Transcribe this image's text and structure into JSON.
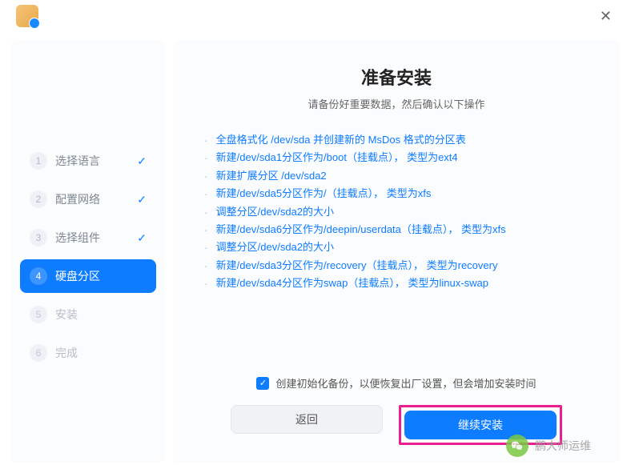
{
  "header": {
    "close_label": "✕"
  },
  "sidebar": {
    "steps": [
      {
        "num": "1",
        "label": "选择语言",
        "state": "completed"
      },
      {
        "num": "2",
        "label": "配置网络",
        "state": "completed"
      },
      {
        "num": "3",
        "label": "选择组件",
        "state": "completed"
      },
      {
        "num": "4",
        "label": "硬盘分区",
        "state": "active"
      },
      {
        "num": "5",
        "label": "安装",
        "state": "pending"
      },
      {
        "num": "6",
        "label": "完成",
        "state": "pending"
      }
    ]
  },
  "content": {
    "title": "准备安装",
    "subtitle": "请备份好重要数据，然后确认以下操作",
    "operations": [
      "全盘格式化 /dev/sda 并创建新的 MsDos 格式的分区表",
      "新建/dev/sda1分区作为/boot（挂载点）， 类型为ext4",
      "新建扩展分区 /dev/sda2",
      "新建/dev/sda5分区作为/（挂载点）， 类型为xfs",
      "调整分区/dev/sda2的大小",
      "新建/dev/sda6分区作为/deepin/userdata（挂载点）， 类型为xfs",
      "调整分区/dev/sda2的大小",
      "新建/dev/sda3分区作为/recovery（挂载点）， 类型为recovery",
      "新建/dev/sda4分区作为swap（挂载点）， 类型为linux-swap"
    ],
    "checkbox_label": "创建初始化备份，以便恢复出厂设置，但会增加安装时间",
    "checkbox_checked": true,
    "back_label": "返回",
    "continue_label": "继续安装"
  },
  "watermark": {
    "text": "鹏大师运维"
  }
}
